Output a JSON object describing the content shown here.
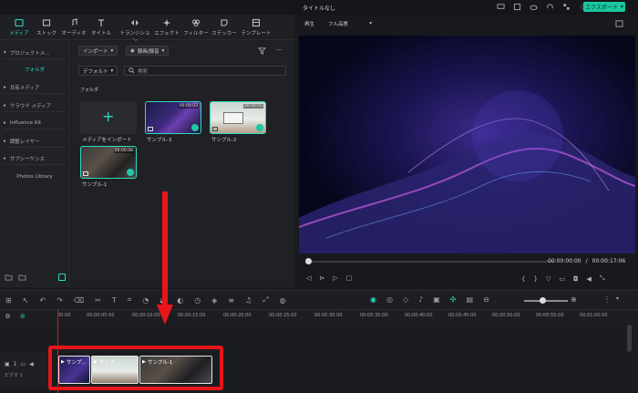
{
  "app": {
    "title": "タイトルなし",
    "export_label": "エクスポート"
  },
  "tabs": [
    {
      "label": "メディア"
    },
    {
      "label": "ストック"
    },
    {
      "label": "オーディオ"
    },
    {
      "label": "タイトル"
    },
    {
      "label": "トランジション"
    },
    {
      "label": "エフェクト"
    },
    {
      "label": "フィルター"
    },
    {
      "label": "ステッカー"
    },
    {
      "label": "テンプレート"
    }
  ],
  "sidebar": {
    "items": [
      {
        "label": "プロジェクトメ..."
      },
      {
        "label": "フォルダ"
      },
      {
        "label": "共有メディア"
      },
      {
        "label": "クラウド メディア"
      },
      {
        "label": "Influence Kit"
      },
      {
        "label": "調整レイヤー"
      },
      {
        "label": "サブシーケンス"
      },
      {
        "label": "Photos Library"
      }
    ]
  },
  "media": {
    "import_label": "インポート",
    "record_label": "録画/録音",
    "sort_label": "デフォルト",
    "search_placeholder": "検索",
    "folder_label": "フォルダ",
    "import_tile_label": "メディアをインポート",
    "items": [
      {
        "name": "サンプル-3",
        "duration": "00:00:03"
      },
      {
        "name": "サンプル-2",
        "duration": "00:00:05"
      },
      {
        "name": "サンプル-1",
        "duration": "00:00:08"
      }
    ]
  },
  "preview": {
    "play_label": "再生",
    "quality_label": "フル品質",
    "current_time": "00:00:00:00",
    "separator": "/",
    "total_time": "00:00:17:06"
  },
  "ruler": {
    "ticks": [
      "00:00",
      "00:00:05:00",
      "00:00:10:00",
      "00:00:15:00",
      "00:00:20:00",
      "00:00:25:00",
      "00:00:30:00",
      "00:00:35:00",
      "00:00:40:00",
      "00:00:45:00",
      "00:00:50:00",
      "00:00:55:00",
      "00:01:00:00"
    ]
  },
  "timeline": {
    "track_label": "ビデオ 1",
    "track_number": "1",
    "clips": [
      {
        "label": "サンプ..."
      },
      {
        "label": "サンプ"
      },
      {
        "label": "サンプル-1"
      }
    ]
  },
  "colors": {
    "accent": "#2fd9c1",
    "export": "#19c8a0",
    "highlight": "#e8151b"
  }
}
